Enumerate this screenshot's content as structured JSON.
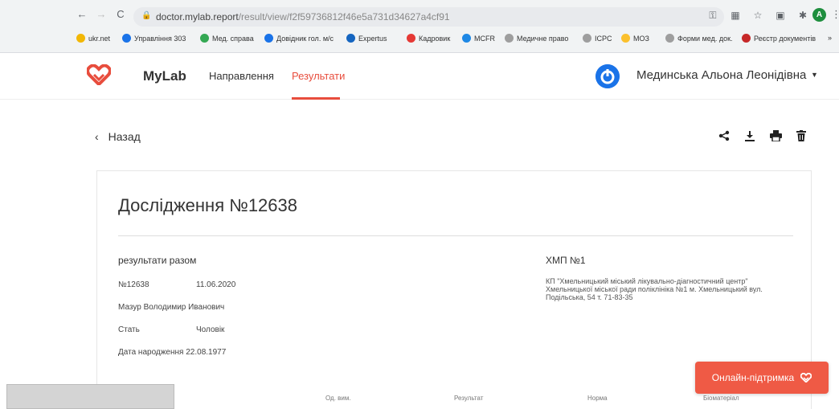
{
  "browser": {
    "url_host": "doctor.mylab.report",
    "url_path": "/result/view/f2f59736812f46e5a731d34627a4cf91",
    "profile_initial": "A",
    "bookmarks": [
      {
        "label": "ukr.net",
        "color": "#f2b705"
      },
      {
        "label": "Управління 303",
        "color": "#1a73e8"
      },
      {
        "label": "Мед. справа",
        "color": "#34a853"
      },
      {
        "label": "Довідник гол. м/с",
        "color": "#1a73e8"
      },
      {
        "label": "Expertus",
        "color": "#1565c0"
      },
      {
        "label": "Кадровик",
        "color": "#e53935"
      },
      {
        "label": "MCFR",
        "color": "#1e88e5"
      },
      {
        "label": "Медичне право",
        "color": "#9e9e9e"
      },
      {
        "label": "ICPC",
        "color": "#9e9e9e"
      },
      {
        "label": "МОЗ",
        "color": "#fbc02d"
      },
      {
        "label": "Форми мед. док.",
        "color": "#9e9e9e"
      },
      {
        "label": "Реєстр документів",
        "color": "#c62828"
      }
    ],
    "more": "»"
  },
  "app": {
    "brand": "MyLab",
    "nav": {
      "referrals": "Направлення",
      "results": "Результати"
    },
    "user_name": "Мединська Альона Леонідівна",
    "accent_color": "#e84d3d"
  },
  "toolbar": {
    "back_label": "Назад",
    "icons": [
      "share-icon",
      "download-icon",
      "print-icon",
      "delete-icon"
    ]
  },
  "study": {
    "title": "Дослідження №12638",
    "section_title": "результати разом",
    "number": "№12638",
    "date": "11.06.2020",
    "patient": "Мазур Володимир Иванович",
    "sex_label": "Стать",
    "sex_value": "Чоловік",
    "dob": "Дата народження 22.08.1977",
    "lab_name": "ХМП №1",
    "lab_address": "КП \"Хмельницький міський лікувально-діагностичний центр\" Хмельницької міської ради поліклініка  №1 м. Хмельницький вул. Подільська, 54 т. 71-83-35"
  },
  "table": {
    "headers": [
      "Од. вим.",
      "Результат",
      "Норма",
      "Біоматеріал"
    ]
  },
  "support": {
    "label": "Онлайн-підтримка"
  }
}
